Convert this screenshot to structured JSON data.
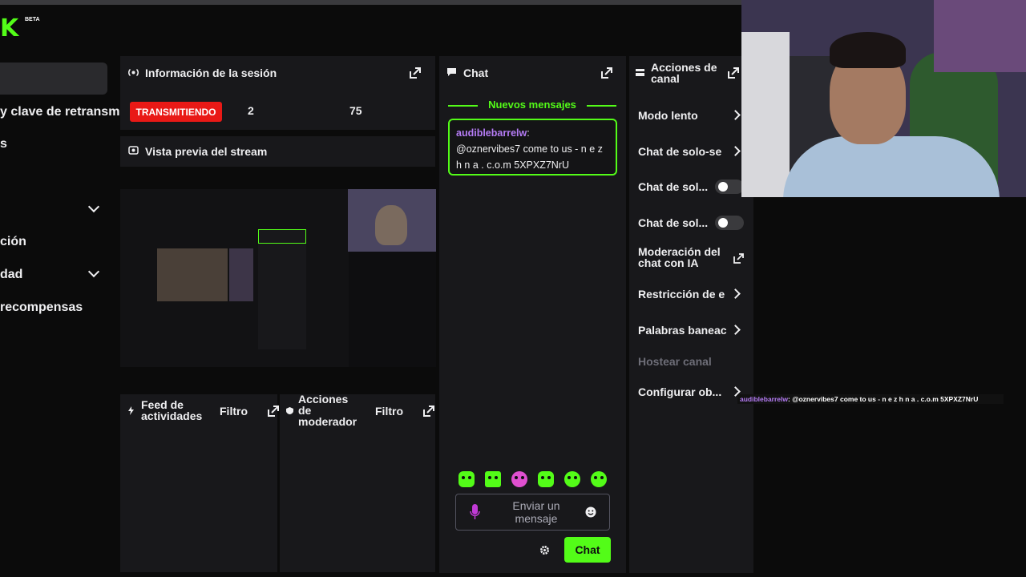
{
  "brand": {
    "logo_text": "K",
    "beta_label": "BETA",
    "accent": "#53fc18"
  },
  "sidebar": {
    "items": [
      {
        "label": "y clave de retransm"
      },
      {
        "label": "s"
      },
      {
        "label": "ción"
      },
      {
        "label": "dad"
      },
      {
        "label": " recompensas"
      }
    ]
  },
  "session": {
    "title": "Información de la sesión",
    "status_badge": "TRANSMITIENDO",
    "stat_a": "2",
    "stat_b": "75"
  },
  "preview": {
    "title": "Vista previa del stream"
  },
  "activity": {
    "title": "Feed de actividades",
    "filter": "Filtro"
  },
  "moderator": {
    "title": "Acciones de moderador",
    "filter": "Filtro"
  },
  "chat": {
    "title": "Chat",
    "new_messages": "Nuevos mensajes",
    "message": {
      "user": "audiblebarrelw",
      "text": "@oznervibes7 come to us - n e z h n a . c.o.m 5XPXZ7NrU"
    },
    "input_placeholder": "Enviar un mensaje",
    "send_label": "Chat"
  },
  "channel_actions": {
    "title": "Acciones de canal",
    "items": [
      {
        "label": "Modo lento",
        "kind": "arrow"
      },
      {
        "label": "Chat de solo-se",
        "kind": "arrow"
      },
      {
        "label": "Chat de sol...",
        "kind": "toggle",
        "on": false
      },
      {
        "label": "Chat de sol...",
        "kind": "toggle",
        "on": false
      },
      {
        "label": "Moderación del chat con IA",
        "kind": "external"
      },
      {
        "label": "Restricción de e",
        "kind": "arrow"
      },
      {
        "label": "Palabras baneac",
        "kind": "arrow"
      },
      {
        "label": "Hostear canal",
        "kind": "disabled"
      },
      {
        "label": "Configurar ob...",
        "kind": "arrow"
      }
    ]
  },
  "overlay": {
    "user": "audiblebarrelw",
    "text": ": @oznervibes7 come to us - n e z h n a . c.o.m 5XPXZ7NrU"
  }
}
